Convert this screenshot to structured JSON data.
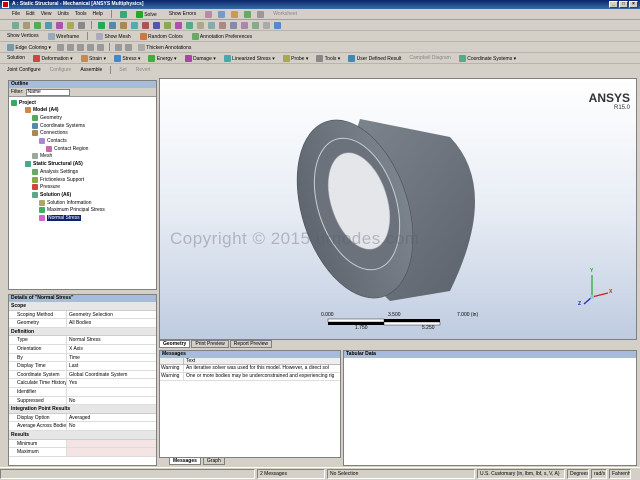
{
  "window": {
    "title": "A : Static Structural - Mechanical [ANSYS Multiphysics]",
    "controls": [
      "_",
      "□",
      "×"
    ]
  },
  "menu": [
    "File",
    "Edit",
    "View",
    "Units",
    "Tools",
    "Help"
  ],
  "toolbar1": {
    "solve": "Solve",
    "show_errors": "Show Errors",
    "worksheet": "Worksheet"
  },
  "toolbar2": {
    "show_vertices": "Show Vertices",
    "wireframe": "Wireframe",
    "show_mesh": "Show Mesh",
    "random_colors": "Random Colors",
    "annotation_prefs": "Annotation Preferences"
  },
  "toolbar3": {
    "edge_coloring": "Edge Coloring",
    "thicken_annotations": "Thicken Annotations"
  },
  "toolbar4": {
    "solution": "Solution",
    "deformation": "Deformation",
    "strain": "Strain",
    "stress": "Stress",
    "energy": "Energy",
    "damage": "Damage",
    "linearized_stress": "Linearized Stress",
    "probe": "Probe",
    "tools": "Tools",
    "user_defined": "User Defined Result",
    "campbell": "Campbell Diagram",
    "coord_systems": "Coordinate Systems"
  },
  "toolbar5": {
    "joint_configure": "Joint Configure",
    "configure": "Configure",
    "assemble": "Assemble",
    "set": "Set",
    "revert": "Revert"
  },
  "outline": {
    "title": "Outline",
    "filter_label": "Filter:",
    "filter_value": "Name",
    "nodes": [
      {
        "label": "Project",
        "bold": true
      },
      {
        "label": "Model (A4)",
        "bold": true
      },
      {
        "label": "Geometry"
      },
      {
        "label": "Coordinate Systems"
      },
      {
        "label": "Connections"
      },
      {
        "label": "Contacts"
      },
      {
        "label": "Contact Region"
      },
      {
        "label": "Mesh"
      },
      {
        "label": "Static Structural (A5)",
        "bold": true
      },
      {
        "label": "Analysis Settings"
      },
      {
        "label": "Frictionless Support"
      },
      {
        "label": "Pressure"
      },
      {
        "label": "Solution (A6)",
        "bold": true
      },
      {
        "label": "Solution Information"
      },
      {
        "label": "Maximum Principal Stress"
      },
      {
        "label": "Normal Stress",
        "selected": true
      }
    ]
  },
  "details": {
    "title": "Details of \"Normal Stress\"",
    "sections": [
      {
        "name": "Scope",
        "rows": [
          [
            "Scoping Method",
            "Geometry Selection"
          ],
          [
            "Geometry",
            "All Bodies"
          ]
        ]
      },
      {
        "name": "Definition",
        "rows": [
          [
            "Type",
            "Normal Stress"
          ],
          [
            "Orientation",
            "X Axis"
          ],
          [
            "By",
            "Time"
          ],
          [
            "Display Time",
            "Last"
          ],
          [
            "Coordinate System",
            "Global Coordinate System"
          ],
          [
            "Calculate Time History",
            "Yes"
          ],
          [
            "Identifier",
            ""
          ],
          [
            "Suppressed",
            "No"
          ]
        ]
      },
      {
        "name": "Integration Point Results",
        "rows": [
          [
            "Display Option",
            "Averaged"
          ],
          [
            "Average Across Bodies",
            "No"
          ]
        ]
      },
      {
        "name": "Results",
        "rows": [
          [
            "Minimum",
            ""
          ],
          [
            "Maximum",
            ""
          ]
        ]
      }
    ]
  },
  "viewport": {
    "brand": "ANSYS",
    "version": "R15.0",
    "watermark": "Copyright © 2015 urnodes.com",
    "scale_top": [
      "0.000",
      "3.500",
      "7.000 (in)"
    ],
    "scale_bottom": [
      "1.750",
      "5.250"
    ],
    "triad": {
      "x": "X",
      "y": "Y",
      "z": "Z"
    }
  },
  "view_tabs": [
    "Geometry",
    "Print Preview",
    "Report Preview"
  ],
  "messages": {
    "title": "Messages",
    "column": "Text",
    "rows": [
      [
        "Warning",
        "An iterative solver was used for this model. However, a direct sol"
      ],
      [
        "Warning",
        "One or more bodies may be underconstrained and experiencing rig"
      ]
    ]
  },
  "tabular": {
    "title": "Tabular Data"
  },
  "bottom_tabs": [
    "Messages",
    "Graph"
  ],
  "status": {
    "messages": "2 Messages",
    "selection": "No Selection",
    "units": "U.S. Customary (in, lbm, lbf, s, V, A)",
    "angle": "Degrees",
    "rate": "rad/s",
    "temp": "Fahrenheit"
  },
  "colors": {
    "accent": "#0a246a",
    "panel_head": "#a7bcd8",
    "model_gray": "#7a8088"
  }
}
